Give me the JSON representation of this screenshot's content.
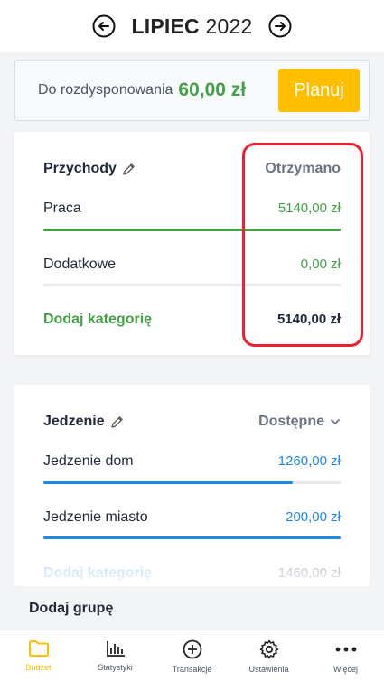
{
  "header": {
    "month": "LIPIEC",
    "year": "2022",
    "prev_icon": "arrow-left-circle-icon",
    "next_icon": "arrow-right-circle-icon"
  },
  "budget": {
    "label": "Do rozdysponowania",
    "amount": "60,00 zł",
    "plan_button": "Planuj"
  },
  "income": {
    "title": "Przychody",
    "column": "Otrzymano",
    "rows": [
      {
        "name": "Praca",
        "value": "5140,00 zł",
        "progress": 1.0
      },
      {
        "name": "Dodatkowe",
        "value": "0,00 zł",
        "progress": 0.0
      }
    ],
    "add_category": "Dodaj kategorię",
    "total": "5140,00 zł"
  },
  "food": {
    "title": "Jedzenie",
    "column": "Dostępne",
    "rows": [
      {
        "name": "Jedzenie dom",
        "value": "1260,00 zł",
        "progress": 0.84
      },
      {
        "name": "Jedzenie miasto",
        "value": "200,00 zł",
        "progress": 1.0
      }
    ],
    "add_category": "Dodaj kategorię",
    "total": "1460,00 zł"
  },
  "add_group": "Dodaj grupę",
  "nav": [
    {
      "label": "Budżet",
      "icon": "folder-icon",
      "active": true
    },
    {
      "label": "Statystyki",
      "icon": "bar-chart-icon",
      "active": false
    },
    {
      "label": "Transakcje",
      "icon": "plus-circle-icon",
      "active": false
    },
    {
      "label": "Ustawienia",
      "icon": "gear-icon",
      "active": false
    },
    {
      "label": "Więcej",
      "icon": "more-dots-icon",
      "active": false
    }
  ],
  "colors": {
    "accent": "#ffbf00",
    "income": "#43a047",
    "blue": "#1e88e5",
    "highlight": "#e8202f"
  }
}
